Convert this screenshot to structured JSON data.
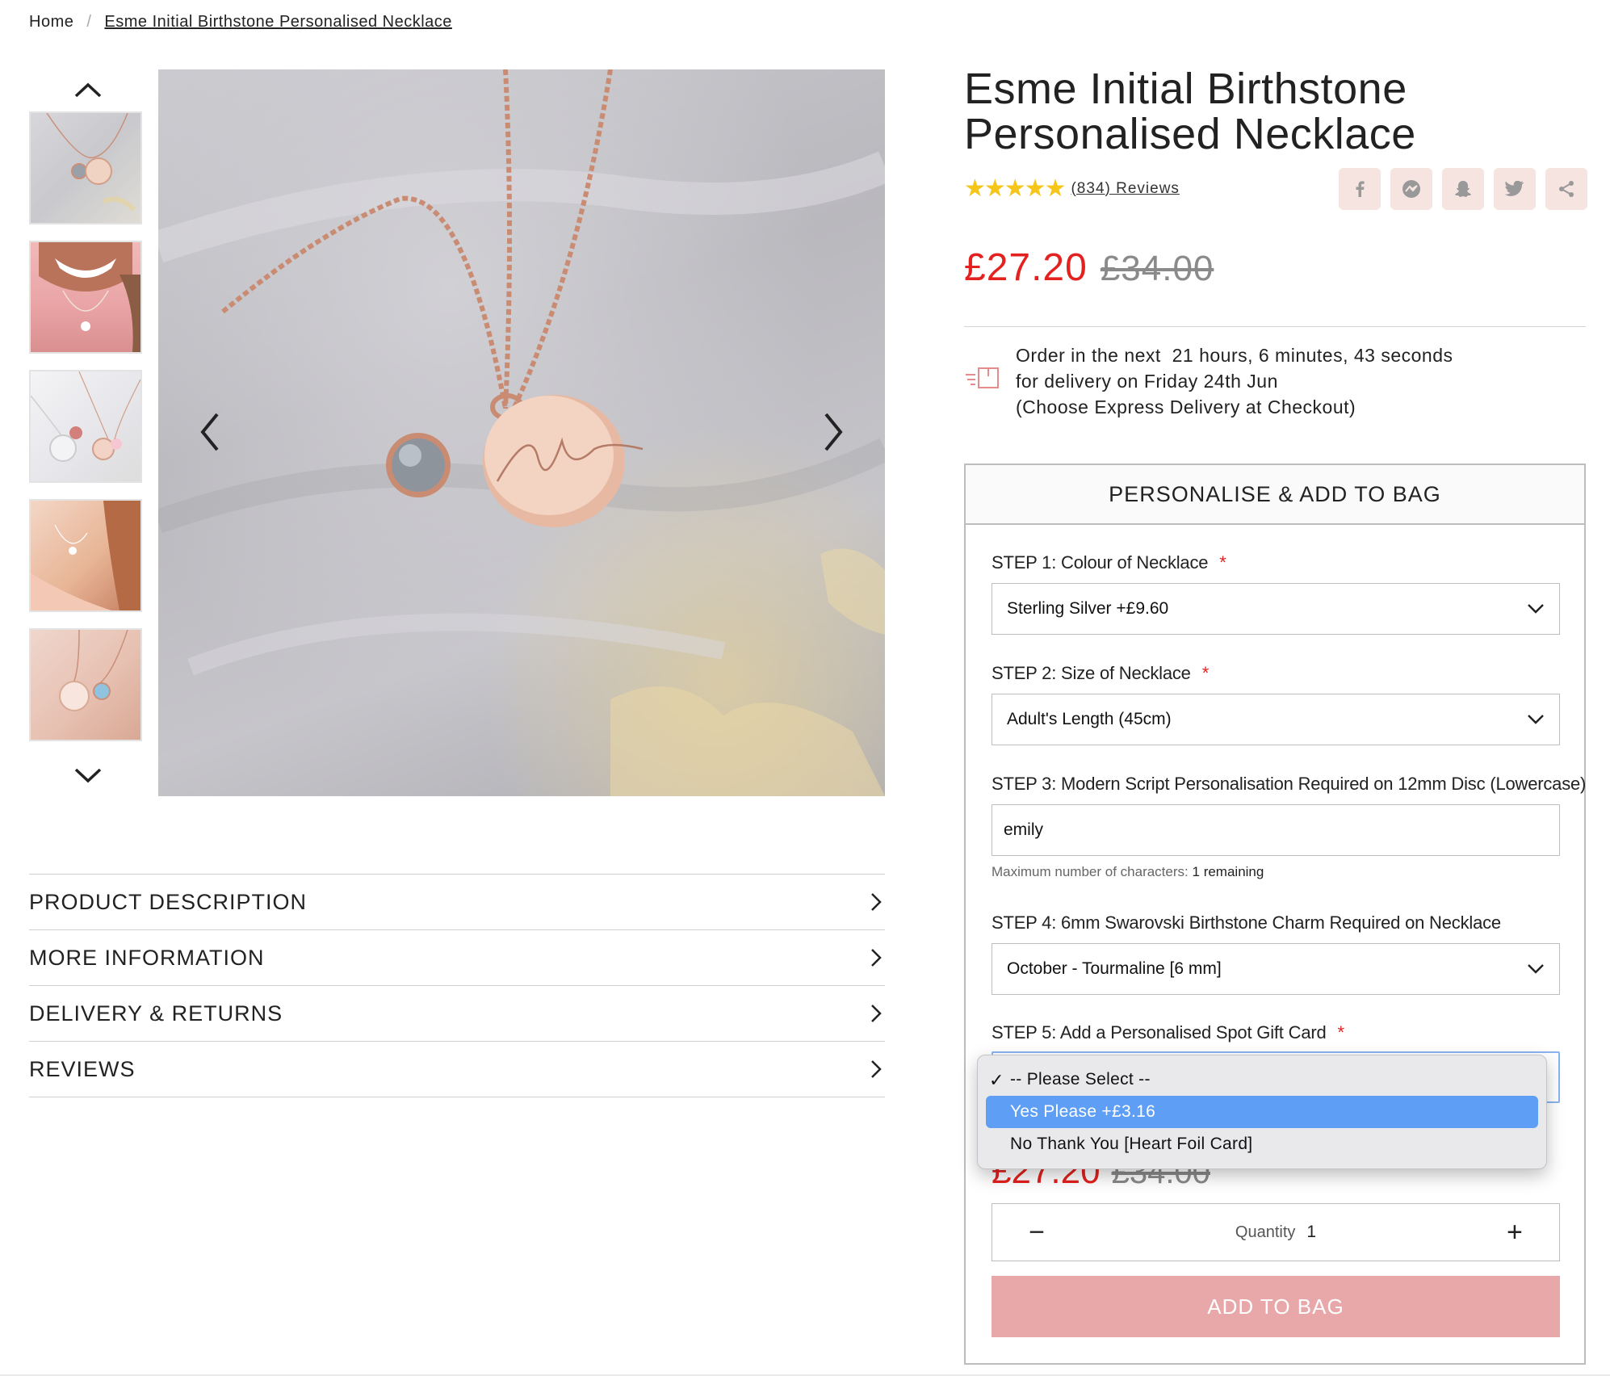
{
  "breadcrumb": {
    "home": "Home",
    "separator": "/",
    "current": "Esme Initial Birthstone Personalised Necklace"
  },
  "product": {
    "title_line1": "Esme Initial Birthstone",
    "title_line2": "Personalised Necklace",
    "stars": "★★★★★",
    "reviews": "(834) Reviews",
    "price_now": "£27.20",
    "price_was": "£34.00"
  },
  "share": {
    "icons": [
      "facebook-icon",
      "messenger-icon",
      "snapchat-icon",
      "twitter-icon",
      "share-icon"
    ]
  },
  "delivery": {
    "line1": "Order in the next  21 hours, 6 minutes, 43 seconds",
    "line2": "for delivery on Friday 24th Jun",
    "line3": "(Choose Express Delivery at Checkout)"
  },
  "personalise": {
    "header": "PERSONALISE & ADD TO BAG",
    "required_mark": "*",
    "step1": {
      "label": "STEP 1: Colour of Necklace",
      "value": "Sterling Silver +£9.60"
    },
    "step2": {
      "label": "STEP 2: Size of Necklace",
      "value": "Adult's Length (45cm)"
    },
    "step3": {
      "label": "STEP 3: Modern Script Personalisation Required on 12mm Disc (Lowercase)",
      "value": "emily",
      "hint_label": "Maximum number of characters:",
      "hint_count": "1",
      "hint_suffix": "remaining"
    },
    "step4": {
      "label": "STEP 4: 6mm Swarovski Birthstone Charm Required on Necklace",
      "value": "October - Tourmaline [6 mm]"
    },
    "step5": {
      "label": "STEP 5: Add a Personalised Spot Gift Card",
      "options": [
        "-- Please Select --",
        "Yes Please +£3.16",
        "No Thank You [Heart Foil Card]"
      ],
      "checked_mark": "✓"
    },
    "price_now": "£27.20",
    "price_was": "£34.00",
    "quantity_label": "Quantity",
    "quantity_value": "1",
    "minus": "−",
    "plus": "+",
    "add_to_bag": "ADD TO BAG"
  },
  "accordion": [
    "PRODUCT DESCRIPTION",
    "MORE INFORMATION",
    "DELIVERY & RETURNS",
    "REVIEWS"
  ],
  "colors": {
    "price_red": "#e3211e",
    "add_button": "#e8a8aa",
    "share_bg": "#f5e4df",
    "star": "#f5c518",
    "dropdown_highlight": "#5e9ff5"
  }
}
